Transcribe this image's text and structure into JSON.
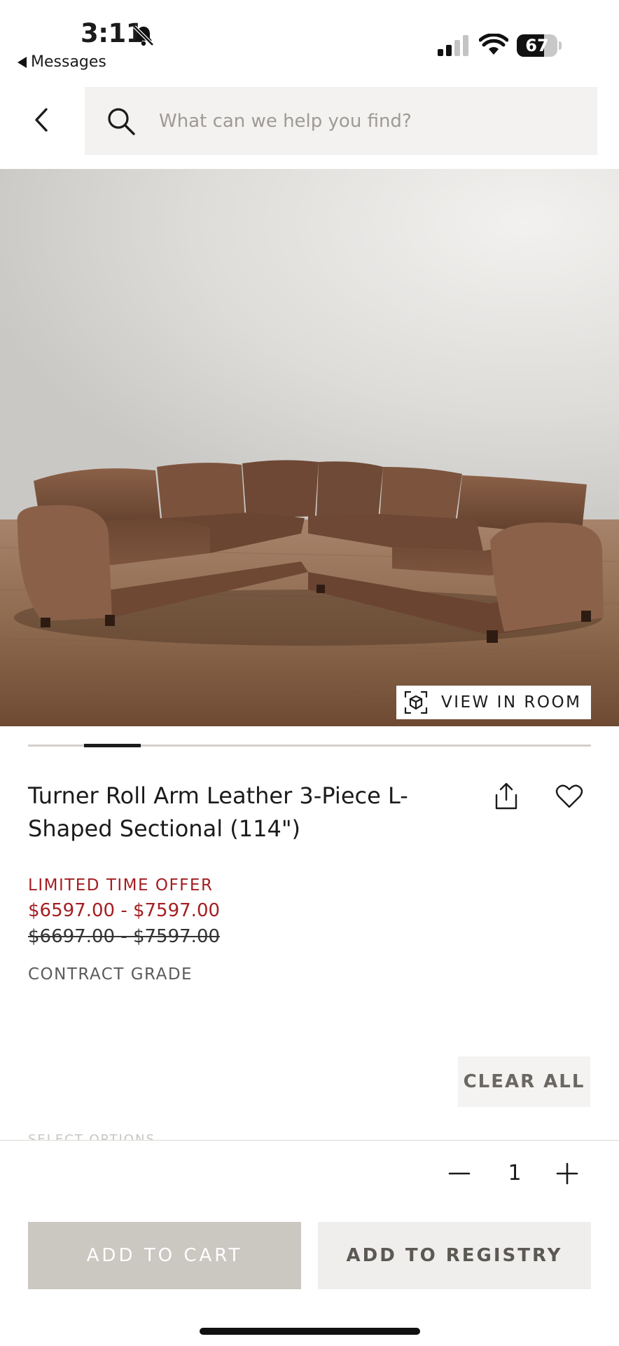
{
  "status_bar": {
    "time": "3:11",
    "back_app": "Messages",
    "battery_level": "67",
    "battery_percent": 67,
    "signal_bars": 2,
    "icons": [
      "bell-slash-icon",
      "cellular-signal-icon",
      "wifi-icon",
      "battery-icon"
    ]
  },
  "header": {
    "back_icon": "chevron-left-icon",
    "search_icon": "search-icon",
    "search_placeholder": "What can we help you find?"
  },
  "hero": {
    "image": "brown leather L-shaped sectional sofa on wood floor",
    "view_in_room_label": "VIEW IN ROOM",
    "view_in_room_icon": "ar-cube-icon",
    "carousel_active_index": 1,
    "carousel_count": 10
  },
  "product": {
    "title": "Turner Roll Arm Leather 3-Piece L-Shaped Sectional (114\")",
    "promo_label": "LIMITED TIME OFFER",
    "sale_price": "$6597.00 - $7597.00",
    "original_price": "$6697.00 - $7597.00",
    "grade": "CONTRACT GRADE",
    "share_icon": "share-icon",
    "favorite_icon": "heart-icon"
  },
  "options": {
    "clear_all_label": "CLEAR ALL"
  },
  "purchase": {
    "quantity": "1",
    "minus_icon": "minus-icon",
    "plus_icon": "plus-icon",
    "add_to_cart_label": "ADD TO CART",
    "add_to_registry_label": "ADD TO REGISTRY"
  },
  "colors": {
    "promo_red": "#a41e22",
    "cart_button": "#cbc7c1",
    "registry_button": "#efeeec",
    "search_bg": "#f3f2f0"
  }
}
